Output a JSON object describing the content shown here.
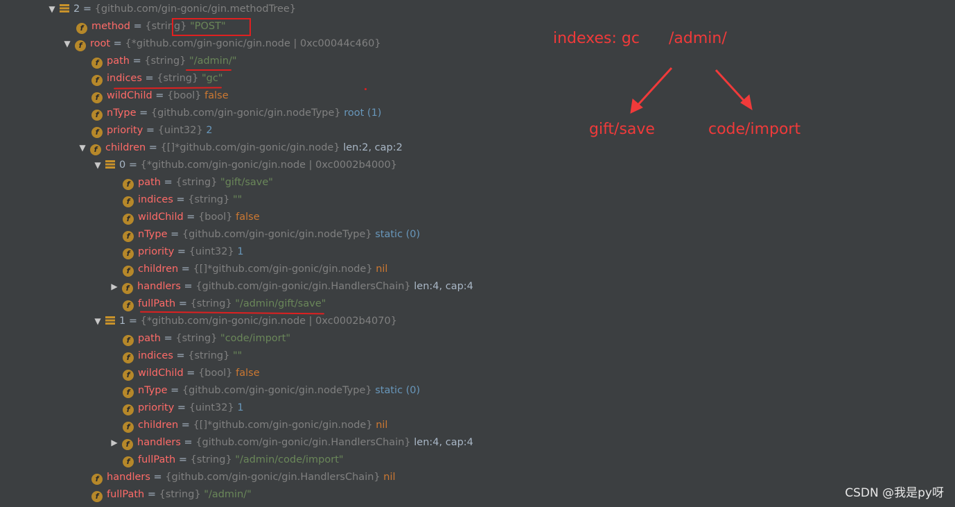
{
  "rows": [
    {
      "arrow": "expanded",
      "icon": "array",
      "name": "2",
      "type": "{github.com/gin-gonic/gin.methodTree}",
      "value": "",
      "value_kind": "",
      "extra": ""
    },
    {
      "arrow": "none",
      "icon": "field",
      "name": "method",
      "type": "{string}",
      "value": "\"POST\"",
      "value_kind": "str",
      "extra": ""
    },
    {
      "arrow": "expanded",
      "icon": "field",
      "name": "root",
      "type": "{*github.com/gin-gonic/gin.node | 0xc00044c460}",
      "value": "",
      "value_kind": "",
      "extra": ""
    },
    {
      "arrow": "none",
      "icon": "field",
      "name": "path",
      "type": "{string}",
      "value": "\"/admin/\"",
      "value_kind": "str",
      "extra": ""
    },
    {
      "arrow": "none",
      "icon": "field",
      "name": "indices",
      "type": "{string}",
      "value": "\"gc\"",
      "value_kind": "str",
      "extra": ""
    },
    {
      "arrow": "none",
      "icon": "field",
      "name": "wildChild",
      "type": "{bool}",
      "value": "false",
      "value_kind": "kw",
      "extra": ""
    },
    {
      "arrow": "none",
      "icon": "field",
      "name": "nType",
      "type": "{github.com/gin-gonic/gin.nodeType}",
      "value": "root (1)",
      "value_kind": "num",
      "extra": ""
    },
    {
      "arrow": "none",
      "icon": "field",
      "name": "priority",
      "type": "{uint32}",
      "value": "2",
      "value_kind": "num",
      "extra": ""
    },
    {
      "arrow": "expanded",
      "icon": "field",
      "name": "children",
      "type": "{[]*github.com/gin-gonic/gin.node}",
      "value": "",
      "value_kind": "",
      "extra": "len:2, cap:2"
    },
    {
      "arrow": "expanded",
      "icon": "array",
      "name": "0",
      "type": "{*github.com/gin-gonic/gin.node | 0xc0002b4000}",
      "value": "",
      "value_kind": "",
      "extra": ""
    },
    {
      "arrow": "none",
      "icon": "field",
      "name": "path",
      "type": "{string}",
      "value": "\"gift/save\"",
      "value_kind": "str",
      "extra": ""
    },
    {
      "arrow": "none",
      "icon": "field",
      "name": "indices",
      "type": "{string}",
      "value": "\"\"",
      "value_kind": "str",
      "extra": ""
    },
    {
      "arrow": "none",
      "icon": "field",
      "name": "wildChild",
      "type": "{bool}",
      "value": "false",
      "value_kind": "kw",
      "extra": ""
    },
    {
      "arrow": "none",
      "icon": "field",
      "name": "nType",
      "type": "{github.com/gin-gonic/gin.nodeType}",
      "value": "static (0)",
      "value_kind": "num",
      "extra": ""
    },
    {
      "arrow": "none",
      "icon": "field",
      "name": "priority",
      "type": "{uint32}",
      "value": "1",
      "value_kind": "num",
      "extra": ""
    },
    {
      "arrow": "none",
      "icon": "field",
      "name": "children",
      "type": "{[]*github.com/gin-gonic/gin.node}",
      "value": "nil",
      "value_kind": "kw",
      "extra": ""
    },
    {
      "arrow": "collapsed",
      "icon": "field",
      "name": "handlers",
      "type": "{github.com/gin-gonic/gin.HandlersChain}",
      "value": "",
      "value_kind": "",
      "extra": "len:4, cap:4"
    },
    {
      "arrow": "none",
      "icon": "field",
      "name": "fullPath",
      "type": "{string}",
      "value": "\"/admin/gift/save\"",
      "value_kind": "str",
      "extra": ""
    },
    {
      "arrow": "expanded",
      "icon": "array",
      "name": "1",
      "type": "{*github.com/gin-gonic/gin.node | 0xc0002b4070}",
      "value": "",
      "value_kind": "",
      "extra": ""
    },
    {
      "arrow": "none",
      "icon": "field",
      "name": "path",
      "type": "{string}",
      "value": "\"code/import\"",
      "value_kind": "str",
      "extra": ""
    },
    {
      "arrow": "none",
      "icon": "field",
      "name": "indices",
      "type": "{string}",
      "value": "\"\"",
      "value_kind": "str",
      "extra": ""
    },
    {
      "arrow": "none",
      "icon": "field",
      "name": "wildChild",
      "type": "{bool}",
      "value": "false",
      "value_kind": "kw",
      "extra": ""
    },
    {
      "arrow": "none",
      "icon": "field",
      "name": "nType",
      "type": "{github.com/gin-gonic/gin.nodeType}",
      "value": "static (0)",
      "value_kind": "num",
      "extra": ""
    },
    {
      "arrow": "none",
      "icon": "field",
      "name": "priority",
      "type": "{uint32}",
      "value": "1",
      "value_kind": "num",
      "extra": ""
    },
    {
      "arrow": "none",
      "icon": "field",
      "name": "children",
      "type": "{[]*github.com/gin-gonic/gin.node}",
      "value": "nil",
      "value_kind": "kw",
      "extra": ""
    },
    {
      "arrow": "collapsed",
      "icon": "field",
      "name": "handlers",
      "type": "{github.com/gin-gonic/gin.HandlersChain}",
      "value": "",
      "value_kind": "",
      "extra": "len:4, cap:4"
    },
    {
      "arrow": "none",
      "icon": "field",
      "name": "fullPath",
      "type": "{string}",
      "value": "\"/admin/code/import\"",
      "value_kind": "str",
      "extra": ""
    },
    {
      "arrow": "none",
      "icon": "field",
      "name": "handlers",
      "type": "{github.com/gin-gonic/gin.HandlersChain}",
      "value": "nil",
      "value_kind": "kw",
      "extra": ""
    },
    {
      "arrow": "none",
      "icon": "field",
      "name": "fullPath",
      "type": "{string}",
      "value": "\"/admin/\"",
      "value_kind": "str",
      "extra": ""
    }
  ],
  "annotations": {
    "indexes": "indexes: gc",
    "root_path": "/admin/",
    "left_child": "gift/save",
    "right_child": "code/import"
  },
  "watermark": "CSDN @我是py呀",
  "colors": {
    "background": "#3c3f41",
    "field_name": "#ff6b68",
    "string_value": "#6a8759",
    "keyword_value": "#cc7832",
    "number_value": "#6897bb",
    "type_text": "#808080",
    "annotation": "#f03a3a"
  }
}
